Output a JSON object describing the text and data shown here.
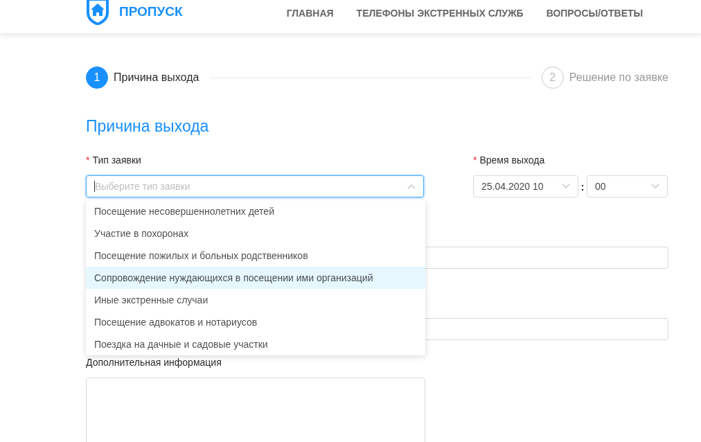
{
  "header": {
    "logo_text": "ПРОПУСК",
    "nav": [
      {
        "label": "ГЛАВНАЯ"
      },
      {
        "label": "ТЕЛЕФОНЫ ЭКСТРЕННЫХ СЛУЖБ"
      },
      {
        "label": "ВОПРОСЫ/ОТВЕТЫ"
      }
    ]
  },
  "stepper": [
    {
      "number": "1",
      "label": "Причина выхода",
      "selected": true
    },
    {
      "number": "2",
      "label": "Решение по заявке",
      "selected": false
    }
  ],
  "section_title": "Причина выхода",
  "type_field": {
    "required_mark": "*",
    "label": "Тип заявки",
    "placeholder": "Выберите тип заявки",
    "expanded": true
  },
  "time_field": {
    "required_mark": "*",
    "label": "Время выхода",
    "date_value": "25.04.2020 10",
    "separator": ":",
    "minute_value": "00"
  },
  "dropdown": [
    {
      "label": "Посещение несовершеннолетних детей",
      "selected": false
    },
    {
      "label": "Участие в похоронах",
      "selected": false
    },
    {
      "label": "Посещение пожилых и больных родственников",
      "selected": false
    },
    {
      "label": "Сопровождение нуждающихся в посещении ими организаций",
      "selected": true
    },
    {
      "label": "Иные экстренные случаи",
      "selected": false
    },
    {
      "label": "Посещение адвокатов и нотариусов",
      "selected": false
    },
    {
      "label": "Поездка на дачные и садовые участки",
      "selected": false
    }
  ],
  "notes_field": {
    "label": "Дополнительная информация"
  }
}
